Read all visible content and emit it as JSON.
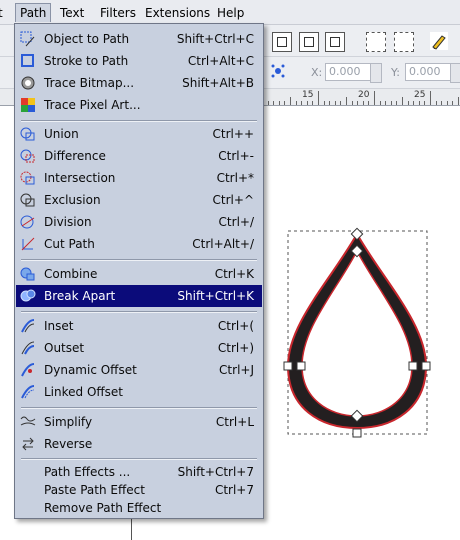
{
  "menubar": {
    "items": [
      {
        "label": "t"
      },
      {
        "label": "Path"
      },
      {
        "label": "Text"
      },
      {
        "label": "Filters"
      },
      {
        "label": "Extensions"
      },
      {
        "label": "Help"
      }
    ]
  },
  "toolbar2": {
    "x_label": "X:",
    "x_value": "0.000",
    "y_label": "Y:",
    "y_value": "0.000"
  },
  "ruler": {
    "labels": [
      "15",
      "20",
      "25"
    ]
  },
  "path_menu": {
    "items": [
      {
        "label": "Object to Path",
        "shortcut": "Shift+Ctrl+C",
        "icon": "object-to-path-icon"
      },
      {
        "label": "Stroke to Path",
        "shortcut": "Ctrl+Alt+C",
        "icon": "stroke-to-path-icon"
      },
      {
        "label": "Trace Bitmap...",
        "shortcut": "Shift+Alt+B",
        "icon": "trace-bitmap-icon"
      },
      {
        "label": "Trace Pixel Art...",
        "shortcut": "",
        "icon": "trace-pixel-art-icon"
      },
      {
        "label": "Union",
        "shortcut": "Ctrl++",
        "icon": "union-icon"
      },
      {
        "label": "Difference",
        "shortcut": "Ctrl+-",
        "icon": "difference-icon"
      },
      {
        "label": "Intersection",
        "shortcut": "Ctrl+*",
        "icon": "intersection-icon"
      },
      {
        "label": "Exclusion",
        "shortcut": "Ctrl+^",
        "icon": "exclusion-icon"
      },
      {
        "label": "Division",
        "shortcut": "Ctrl+/",
        "icon": "division-icon"
      },
      {
        "label": "Cut Path",
        "shortcut": "Ctrl+Alt+/",
        "icon": "cut-path-icon"
      },
      {
        "label": "Combine",
        "shortcut": "Ctrl+K",
        "icon": "combine-icon"
      },
      {
        "label": "Break Apart",
        "shortcut": "Shift+Ctrl+K",
        "icon": "break-apart-icon",
        "highlighted": true
      },
      {
        "label": "Inset",
        "shortcut": "Ctrl+(",
        "icon": "inset-icon"
      },
      {
        "label": "Outset",
        "shortcut": "Ctrl+)",
        "icon": "outset-icon"
      },
      {
        "label": "Dynamic Offset",
        "shortcut": "Ctrl+J",
        "icon": "dynamic-offset-icon"
      },
      {
        "label": "Linked Offset",
        "shortcut": "",
        "icon": "linked-offset-icon"
      },
      {
        "label": "Simplify",
        "shortcut": "Ctrl+L",
        "icon": "simplify-icon"
      },
      {
        "label": "Reverse",
        "shortcut": "",
        "icon": "reverse-icon"
      },
      {
        "label": "Path Effects ...",
        "shortcut": "Shift+Ctrl+7",
        "icon": ""
      },
      {
        "label": "Paste Path Effect",
        "shortcut": "Ctrl+7",
        "icon": ""
      },
      {
        "label": "Remove Path Effect",
        "shortcut": "",
        "icon": ""
      }
    ]
  },
  "colors": {
    "menu_bg": "#c8d0df",
    "highlight": "#0b0b7a",
    "drop_fill": "#231f20",
    "drop_stroke": "#c8272d"
  }
}
